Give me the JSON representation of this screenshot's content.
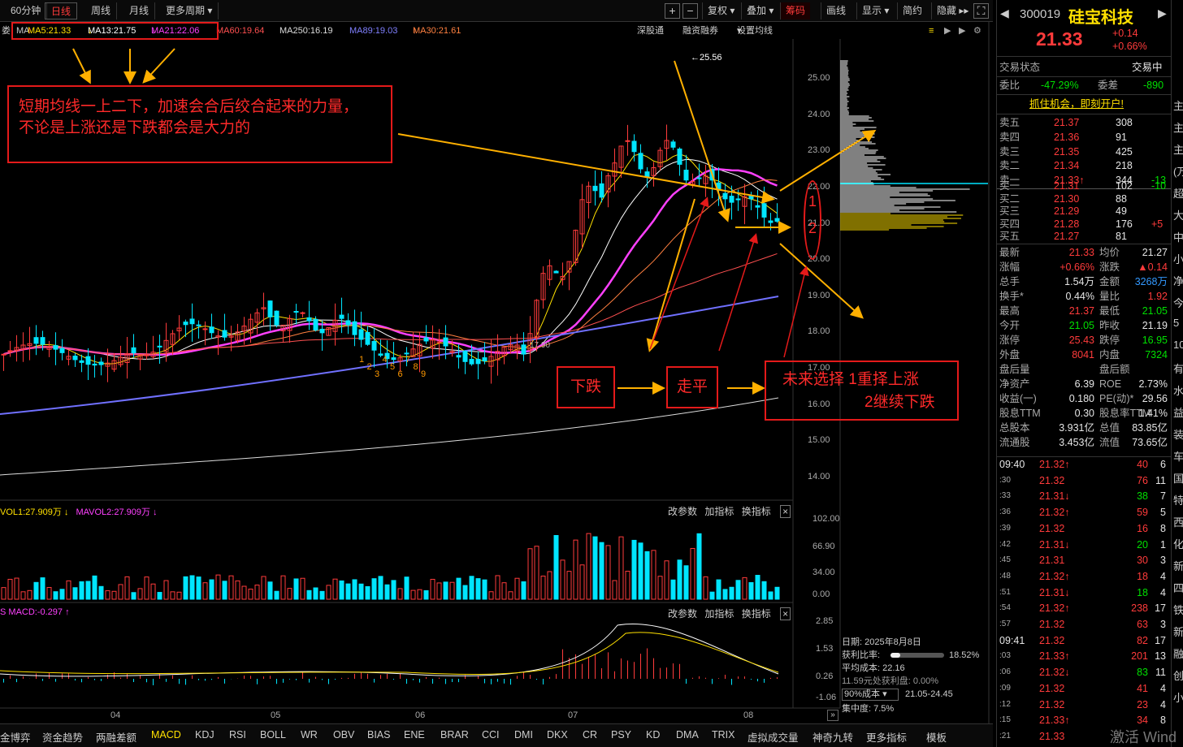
{
  "toolbar": {
    "periods": [
      "60分钟",
      "日线",
      "周线",
      "月线",
      "更多周期"
    ],
    "active_period": "日线",
    "tools": [
      "复权",
      "叠加",
      "筹码",
      "画线",
      "显示",
      "简约",
      "隐藏"
    ],
    "active_tool": "筹码"
  },
  "ma_line": {
    "prefix": "MA",
    "ma5": "MA5:21.33",
    "ma13": "MA13:21.75",
    "ma21": "MA21:22.06",
    "ma60": "MA60:19.64",
    "ma250": "MA250:16.19",
    "ma89": "MA89:19.03",
    "ma30": "MA30:21.61",
    "links": [
      "深股通",
      "融资融券",
      "设置均线"
    ]
  },
  "price_axis": [
    "25.00",
    "24.00",
    "23.00",
    "22.00",
    "21.00",
    "20.00",
    "19.00",
    "18.00",
    "17.00",
    "16.00",
    "15.00",
    "14.00"
  ],
  "peak_label": "25.56",
  "low_label": "17.90",
  "vol_header": {
    "vol": "VOL1:27.909万",
    "mavol": "MAVOL2:27.909万"
  },
  "vol_axis": [
    "102.00",
    "66.90",
    "34.00",
    "0.00"
  ],
  "macd_header": {
    "macd": "MACD:-0.297"
  },
  "macd_axis": [
    "2.85",
    "1.53",
    "0.26",
    "-1.06"
  ],
  "panel_links": [
    "改参数",
    "加指标",
    "换指标"
  ],
  "x_axis": [
    "04",
    "05",
    "06",
    "07",
    "08"
  ],
  "count_labels": [
    "1",
    "2",
    "3",
    "4",
    "5",
    "6",
    "7",
    "8",
    "9"
  ],
  "chip_info": {
    "date": "日期: 2025年8月8日",
    "profit_ratio_label": "获利比率:",
    "profit_ratio_value": "18.52%",
    "profit_ratio": 0.1852,
    "avg_cost": "平均成本: 22.16",
    "profit_line": "11.59元处获利盘: 0.00%",
    "cost_select": "90%成本",
    "cost_range": "21.05-24.45",
    "concentration": "集中度: 7.5%"
  },
  "annotations": {
    "box1_line1": "短期均线一上二下，加速会合后绞合起来的力量，",
    "box1_line2": "不论是上涨还是下跌都会是大力的",
    "box_down": "下跌",
    "box_flat": "走平",
    "box_future_1": "未来选择  1重择上涨",
    "box_future_2": "2继续下跌",
    "circle_1": "1",
    "circle_2": "2"
  },
  "quote": {
    "code": "300019",
    "name": "硅宝科技",
    "price": "21.33",
    "change": "+0.14",
    "change_pct": "+0.66%",
    "status_label": "交易状态",
    "status_value": "交易中",
    "wei_bi_label": "委比",
    "wei_bi": "-47.29%",
    "wei_cha_label": "委差",
    "wei_cha": "-890",
    "promo": "抓住机会，即刻开户!",
    "asks": [
      {
        "label": "卖五",
        "price": "21.37",
        "vol": "308",
        "chg": ""
      },
      {
        "label": "卖四",
        "price": "21.36",
        "vol": "91",
        "chg": ""
      },
      {
        "label": "卖三",
        "price": "21.35",
        "vol": "425",
        "chg": ""
      },
      {
        "label": "卖二",
        "price": "21.34",
        "vol": "218",
        "chg": ""
      },
      {
        "label": "卖一",
        "price": "21.33↑",
        "vol": "344",
        "chg": "-13"
      }
    ],
    "bids": [
      {
        "label": "买一",
        "price": "21.31",
        "vol": "102",
        "chg": "-10"
      },
      {
        "label": "买二",
        "price": "21.30",
        "vol": "88",
        "chg": ""
      },
      {
        "label": "买三",
        "price": "21.29",
        "vol": "49",
        "chg": ""
      },
      {
        "label": "买四",
        "price": "21.28",
        "vol": "176",
        "chg": "+5"
      },
      {
        "label": "买五",
        "price": "21.27",
        "vol": "81",
        "chg": ""
      }
    ],
    "stats": [
      [
        "最新",
        "21.33",
        "均价",
        "21.27"
      ],
      [
        "涨幅",
        "+0.66%",
        "涨跌",
        "▲0.14"
      ],
      [
        "总手",
        "1.54万",
        "金额",
        "3268万"
      ],
      [
        "换手*",
        "0.44%",
        "量比",
        "1.92"
      ],
      [
        "最高",
        "21.37",
        "最低",
        "21.05"
      ],
      [
        "今开",
        "21.05",
        "昨收",
        "21.19"
      ],
      [
        "涨停",
        "25.43",
        "跌停",
        "16.95"
      ],
      [
        "外盘",
        "8041",
        "内盘",
        "7324"
      ],
      [
        "盘后量",
        "",
        "盘后额",
        ""
      ],
      [
        "净资产",
        "6.39",
        "ROE",
        "2.73%"
      ],
      [
        "收益(一)",
        "0.180",
        "PE(动)*",
        "29.56"
      ],
      [
        "股息TTM",
        "0.30",
        "股息率TTM",
        "1.41%"
      ],
      [
        "总股本",
        "3.931亿",
        "总值",
        "83.85亿"
      ],
      [
        "流通股",
        "3.453亿",
        "流值",
        "73.65亿"
      ]
    ],
    "ticks": [
      {
        "t": "09:40",
        "p": "21.32↑",
        "v": "40",
        "n": "6"
      },
      {
        "t": ":30",
        "p": "21.32",
        "v": "76",
        "n": "11"
      },
      {
        "t": ":33",
        "p": "21.31↓",
        "v": "38",
        "n": "7"
      },
      {
        "t": ":36",
        "p": "21.32↑",
        "v": "59",
        "n": "5"
      },
      {
        "t": ":39",
        "p": "21.32",
        "v": "16",
        "n": "8"
      },
      {
        "t": ":42",
        "p": "21.31↓",
        "v": "20",
        "n": "1"
      },
      {
        "t": ":45",
        "p": "21.31",
        "v": "30",
        "n": "3"
      },
      {
        "t": ":48",
        "p": "21.32↑",
        "v": "18",
        "n": "4"
      },
      {
        "t": ":51",
        "p": "21.31↓",
        "v": "18",
        "n": "4"
      },
      {
        "t": ":54",
        "p": "21.32↑",
        "v": "238",
        "n": "17"
      },
      {
        "t": ":57",
        "p": "21.32",
        "v": "63",
        "n": "3"
      },
      {
        "t": "09:41",
        "p": "21.32",
        "v": "82",
        "n": "17"
      },
      {
        "t": ":03",
        "p": "21.33↑",
        "v": "201",
        "n": "13"
      },
      {
        "t": ":06",
        "p": "21.32↓",
        "v": "83",
        "n": "11"
      },
      {
        "t": ":09",
        "p": "21.32",
        "v": "41",
        "n": "4"
      },
      {
        "t": ":12",
        "p": "21.32",
        "v": "23",
        "n": "4"
      },
      {
        "t": ":15",
        "p": "21.33↑",
        "v": "34",
        "n": "8"
      },
      {
        "t": ":21",
        "p": "21.33",
        "v": "",
        "n": ""
      }
    ]
  },
  "bottom_tabs": [
    "金博弈",
    "资金趋势",
    "两融差额",
    "MACD",
    "KDJ",
    "RSI",
    "BOLL",
    "WR",
    "OBV",
    "BIAS",
    "ENE",
    "BRAR",
    "CCI",
    "DMI",
    "DKX",
    "CR",
    "PSY",
    "KD",
    "DMA",
    "TRIX",
    "虚拟成交量",
    "神奇九转",
    "更多指标",
    "模板"
  ],
  "active_bottom_tab": "MACD",
  "watermark": "激活 Wind",
  "far_right": [
    "主",
    "主",
    "主",
    "(万",
    "超",
    "大",
    "中",
    "小",
    "净",
    "今",
    "5",
    "10",
    "有",
    "水",
    "益",
    "装",
    "车",
    "国",
    "特",
    "西",
    "化",
    "新",
    "四",
    "铁",
    "新",
    "融",
    "创",
    "小"
  ]
}
